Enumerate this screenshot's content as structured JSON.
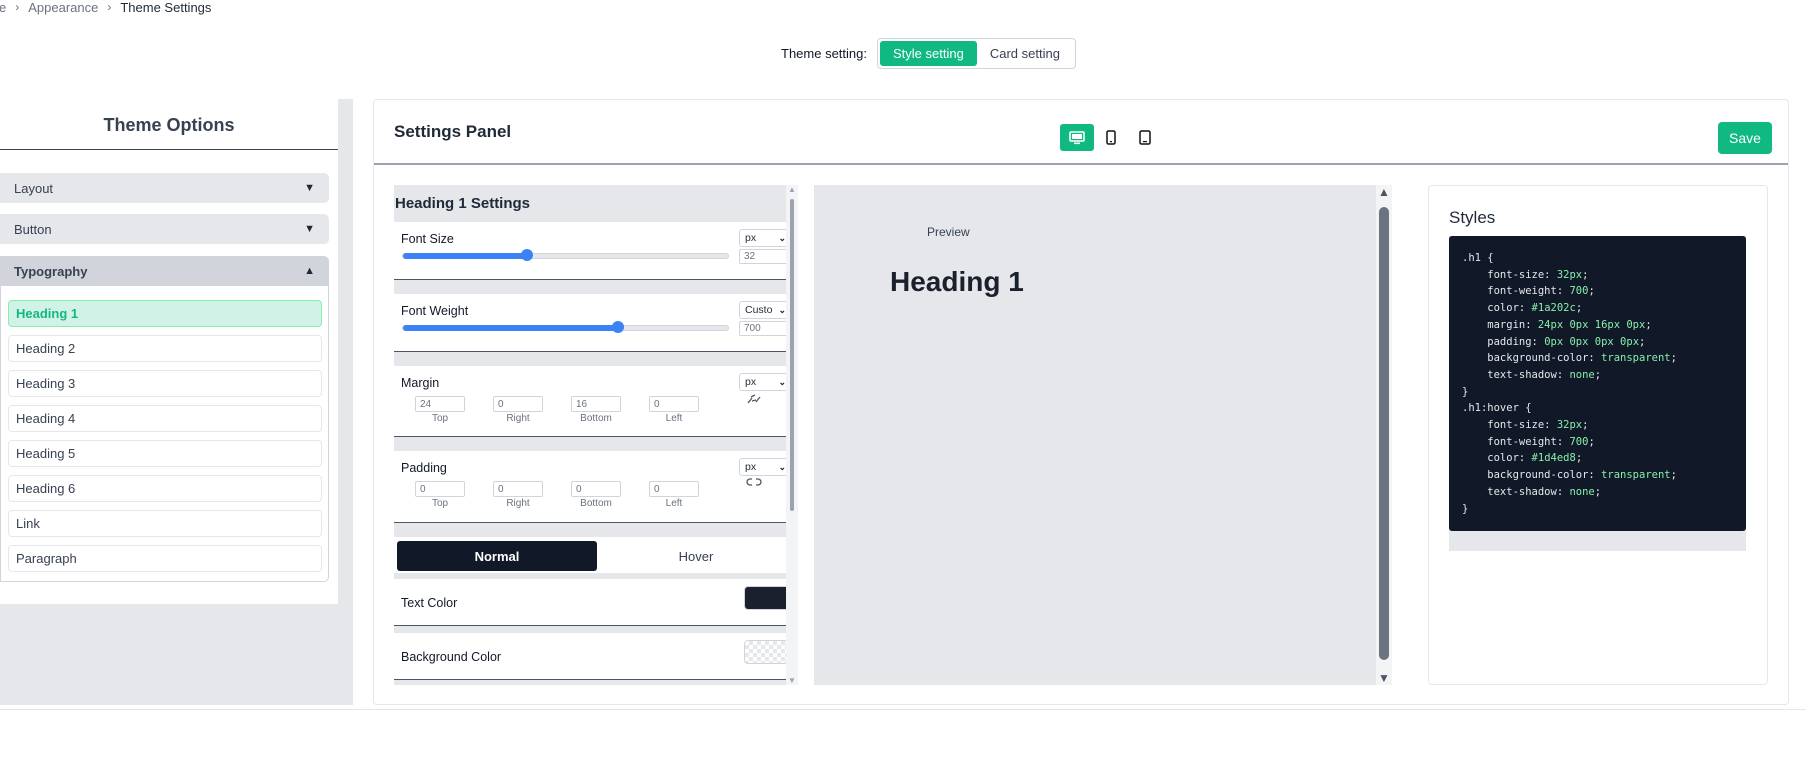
{
  "breadcrumb": {
    "first": "e",
    "second": "Appearance",
    "current": "Theme Settings"
  },
  "theme_setting": {
    "label": "Theme setting:",
    "options": [
      "Style setting",
      "Card setting"
    ],
    "active": "Style setting"
  },
  "theme_options": {
    "title": "Theme Options",
    "sections": [
      {
        "label": "Layout",
        "arrow": "▼"
      },
      {
        "label": "Button",
        "arrow": "▼"
      },
      {
        "label": "Typography",
        "arrow": "▲"
      }
    ],
    "typography_items": [
      "Heading 1",
      "Heading 2",
      "Heading 3",
      "Heading 4",
      "Heading 5",
      "Heading 6",
      "Link",
      "Paragraph"
    ],
    "active_item": "Heading 1"
  },
  "settings_panel": {
    "title": "Settings Panel",
    "save_label": "Save",
    "devices": [
      "desktop-icon",
      "mobile-icon",
      "tablet-icon"
    ],
    "active_device": "desktop"
  },
  "heading_settings": {
    "title": "Heading 1 Settings",
    "font_size": {
      "label": "Font Size",
      "unit": "px",
      "value": "32",
      "slider_fraction": 0.38
    },
    "font_weight": {
      "label": "Font Weight",
      "unit": "Custo",
      "value": "700",
      "slider_fraction": 0.66
    },
    "margin": {
      "label": "Margin",
      "unit": "px",
      "values": [
        "24",
        "0",
        "16",
        "0"
      ],
      "sides": [
        "Top",
        "Right",
        "Bottom",
        "Left"
      ]
    },
    "padding": {
      "label": "Padding",
      "unit": "px",
      "values": [
        "0",
        "0",
        "0",
        "0"
      ],
      "sides": [
        "Top",
        "Right",
        "Bottom",
        "Left"
      ]
    },
    "states": [
      "Normal",
      "Hover"
    ],
    "active_state": "Normal",
    "text_color": {
      "label": "Text Color",
      "color": "#1a202c"
    },
    "background_color": {
      "label": "Background Color",
      "color": "transparent"
    }
  },
  "preview": {
    "label": "Preview",
    "heading": "Heading 1"
  },
  "styles": {
    "title": "Styles",
    "code": ".h1 {\n    font-size: 32px;\n    font-weight: 700;\n    color: #1a202c;\n    margin: 24px 0px 16px 0px;\n    padding: 0px 0px 0px 0px;\n    background-color: transparent;\n    text-shadow: none;\n}\n.h1:hover {\n    font-size: 32px;\n    font-weight: 700;\n    color: #1d4ed8;\n    background-color: transparent;\n    text-shadow: none;\n}"
  },
  "colors": {
    "accent": "#10b981",
    "slider": "#3b82f6",
    "code_bg": "#111827",
    "code_value": "#86efac"
  }
}
